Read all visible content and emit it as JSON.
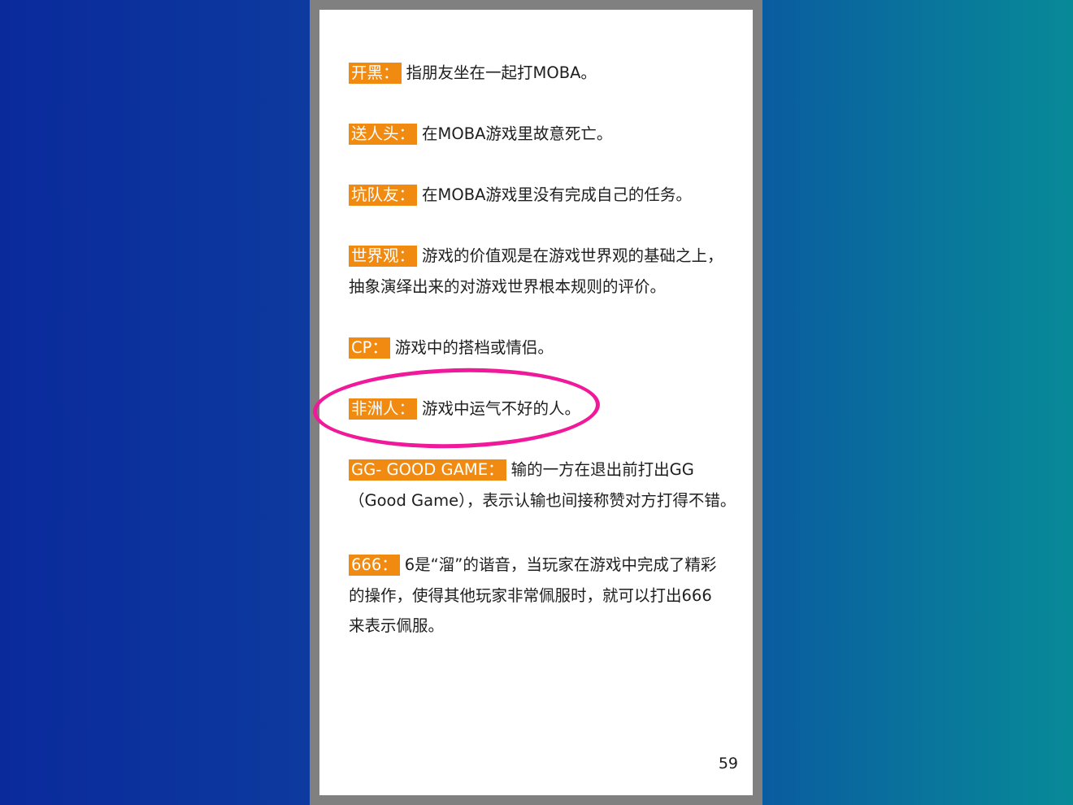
{
  "colors": {
    "term_background": "#f08a11",
    "highlight_circle": "#f0199a",
    "text": "#1e1e1e"
  },
  "entries": [
    {
      "term": "开黑：",
      "lines": [
        "指朋友坐在一起打MOBA。"
      ]
    },
    {
      "term": "送人头：",
      "lines": [
        "在MOBA游戏里故意死亡。"
      ]
    },
    {
      "term": "坑队友：",
      "lines": [
        "在MOBA游戏里没有完成自己的任务。"
      ]
    },
    {
      "term": "世界观：",
      "lines": [
        "游戏的价值观是在游戏世界观的基础之上，",
        "抽象演绎出来的对游戏世界根本规则的评价。"
      ]
    },
    {
      "term": "CP：",
      "lines": [
        "游戏中的搭档或情侣。"
      ]
    },
    {
      "term": "非洲人：",
      "lines": [
        "游戏中运气不好的人。"
      ]
    },
    {
      "term": "GG- GOOD GAME：",
      "lines": [
        "输的一方在退出前打出GG",
        "（Good Game），表示认输也间接称赞对方打得不错。"
      ]
    },
    {
      "term": "666：",
      "lines": [
        "6是“溜”的谐音，当玩家在游戏中完成了精彩",
        "的操作，使得其他玩家非常佩服时，就可以打出666",
        "来表示佩服。"
      ]
    }
  ],
  "page_number": "59"
}
